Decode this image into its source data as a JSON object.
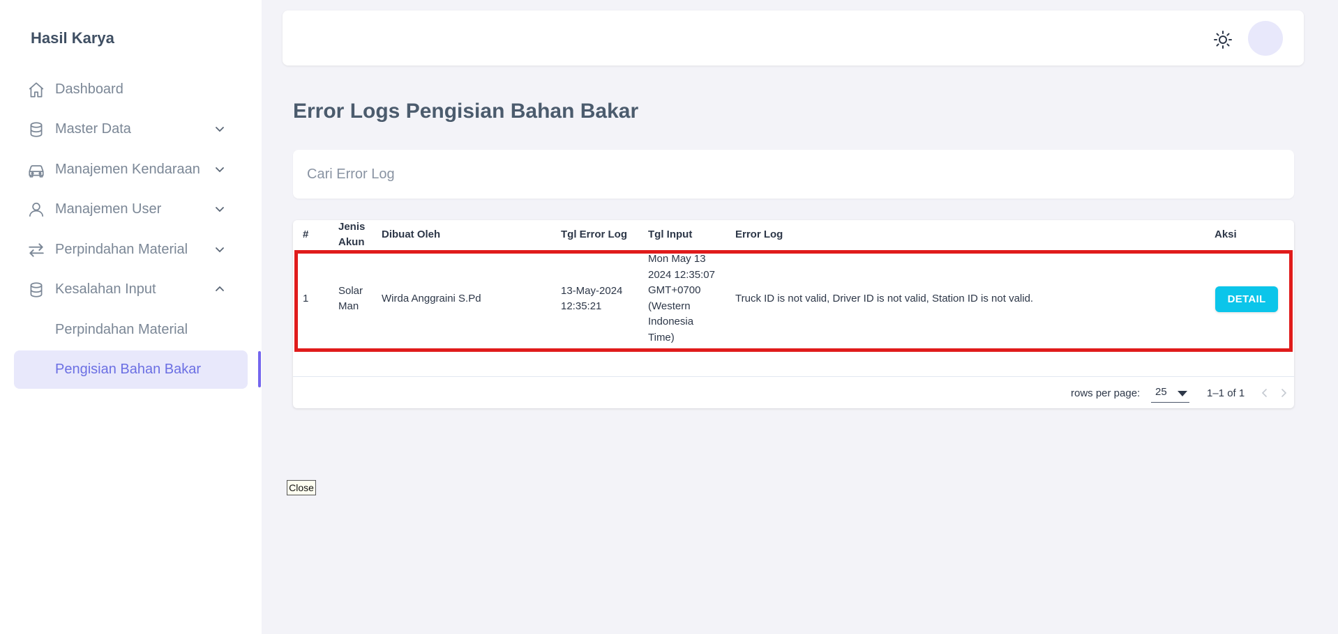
{
  "sidebar": {
    "brand": "Hasil Karya",
    "items": [
      {
        "label": "Dashboard",
        "icon": "home-icon"
      },
      {
        "label": "Master Data",
        "icon": "database-icon"
      },
      {
        "label": "Manajemen Kendaraan",
        "icon": "car-icon"
      },
      {
        "label": "Manajemen User",
        "icon": "user-icon"
      },
      {
        "label": "Perpindahan Material",
        "icon": "swap-icon"
      },
      {
        "label": "Kesalahan Input",
        "icon": "database-icon"
      }
    ],
    "sub_items": [
      {
        "label": "Perpindahan Material"
      },
      {
        "label": "Pengisian Bahan Bakar",
        "active": true
      }
    ]
  },
  "header": {
    "theme_icon": "sun-icon",
    "avatar_icon": "avatar"
  },
  "main": {
    "title": "Error Logs Pengisian Bahan Bakar",
    "search": {
      "placeholder": "Cari Error Log",
      "value": ""
    },
    "table": {
      "headers": {
        "no": "#",
        "jenis_akun_1": "Jenis",
        "jenis_akun_2": "Akun",
        "dibuat_oleh": "Dibuat Oleh",
        "tgl_error_log": "Tgl Error Log",
        "tgl_input": "Tgl Input",
        "error_log": "Error Log",
        "aksi": "Aksi"
      },
      "rows": [
        {
          "no": "1",
          "jenis_akun_1": "Solar",
          "jenis_akun_2": "Man",
          "dibuat_oleh": "Wirda Anggraini S.Pd",
          "tgl_error_log_1": "13-May-2024",
          "tgl_error_log_2": "12:35:21",
          "tgl_input_lines": [
            "Mon May 13",
            "2024 12:35:07",
            "GMT+0700",
            "(Western",
            "Indonesia",
            "Time)"
          ],
          "error_log": "Truck ID is not valid, Driver ID is not valid, Station ID is not valid.",
          "action_label": "DETAIL"
        }
      ],
      "footer": {
        "rows_per_page_label": "rows per page:",
        "rows_per_page_value": "25",
        "range": "1–1 of 1"
      }
    },
    "close_label": "Close"
  },
  "colors": {
    "accent": "#6b6fe3",
    "active_bg": "#e8e8fb",
    "detail_button": "#0bc5ea",
    "highlight": "#e01b1b"
  }
}
